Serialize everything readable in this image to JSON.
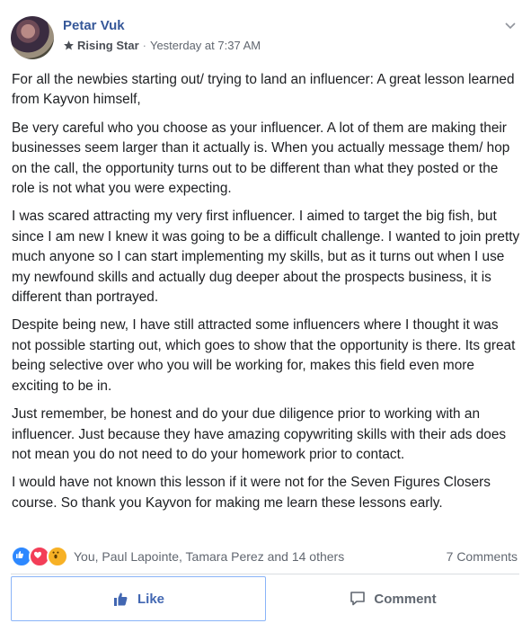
{
  "post": {
    "author": "Petar Vuk",
    "badge": "Rising Star",
    "separator": "·",
    "timestamp": "Yesterday at 7:37 AM",
    "paragraphs": [
      "For all the newbies starting out/ trying to land an influencer: A great lesson learned from Kayvon himself,",
      "Be very careful who you choose as your influencer. A lot of them are making their businesses seem larger than it actually is. When you actually message them/ hop on the call, the opportunity turns out to be different than what they posted or the role is not what you were expecting.",
      "I was scared attracting my very first influencer. I aimed to target the big fish, but since I am new I knew it was going to be a difficult challenge. I wanted to join pretty much anyone so I can start implementing my skills, but as it turns out when I use my newfound skills and actually dug deeper about the prospects business, it is different than portrayed.",
      "Despite being new, I have still attracted some influencers where I thought it was not possible starting out, which goes to show that the opportunity is there. Its great being selective over who you will be working for, makes this field even more exciting to be in.",
      "Just remember, be honest and do your due diligence prior to working with an influencer. Just because they have amazing copywriting skills with their ads does not mean you do not need to do your homework prior to contact.",
      "I would have not known this lesson if it were not for the Seven Figures Closers course. So thank you Kayvon for making me learn these lessons early."
    ]
  },
  "reactions": {
    "icons": [
      "like-icon",
      "love-icon",
      "wow-icon"
    ],
    "names": "You, Paul Lapointe, Tamara Perez and 14 others",
    "comments": "7 Comments"
  },
  "actions": {
    "like_label": "Like",
    "comment_label": "Comment"
  },
  "colors": {
    "link_blue": "#365899",
    "like_blue": "#4267b2",
    "love_red": "#f33e58",
    "wow_yellow": "#f7b125"
  }
}
